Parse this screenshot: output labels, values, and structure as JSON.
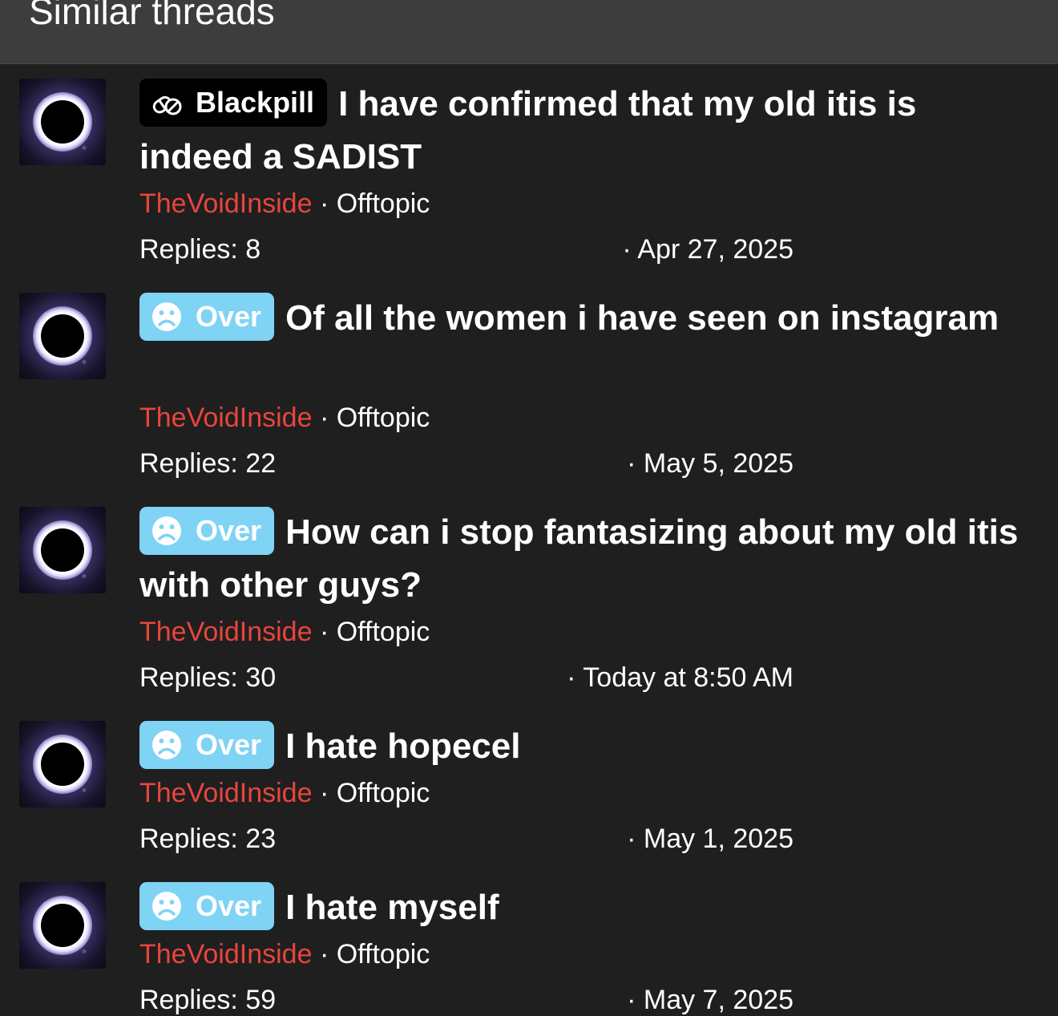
{
  "section_title": "Similar threads",
  "separator": "·",
  "threads": [
    {
      "prefix": "Blackpill",
      "prefix_icon": "pills-icon",
      "title": "I have confirmed that my old itis is indeed a SADIST",
      "author": "TheVoidInside",
      "forum": "Offtopic",
      "replies": "Replies: 8",
      "date": "· Apr 27, 2025"
    },
    {
      "prefix": "Over",
      "prefix_icon": "sad-face-icon",
      "title": "Of all the women i have seen on instagram",
      "author": "TheVoidInside",
      "forum": "Offtopic",
      "replies": "Replies: 22",
      "date": "· May 5, 2025"
    },
    {
      "prefix": "Over",
      "prefix_icon": "sad-face-icon",
      "title": "How can i stop fantasizing about my old itis with other guys?",
      "author": "TheVoidInside",
      "forum": "Offtopic",
      "replies": "Replies: 30",
      "date": "· Today at 8:50 AM"
    },
    {
      "prefix": "Over",
      "prefix_icon": "sad-face-icon",
      "title": "I hate hopecel",
      "author": "TheVoidInside",
      "forum": "Offtopic",
      "replies": "Replies: 23",
      "date": "· May 1, 2025"
    },
    {
      "prefix": "Over",
      "prefix_icon": "sad-face-icon",
      "title": "I hate myself",
      "author": "TheVoidInside",
      "forum": "Offtopic",
      "replies": "Replies: 59",
      "date": "· May 7, 2025"
    }
  ],
  "colors": {
    "background": "#1f1f1f",
    "header": "#3d3d3d",
    "author": "#e8453c",
    "over_prefix": "#7fd3f5",
    "blackpill_prefix": "#000000"
  }
}
